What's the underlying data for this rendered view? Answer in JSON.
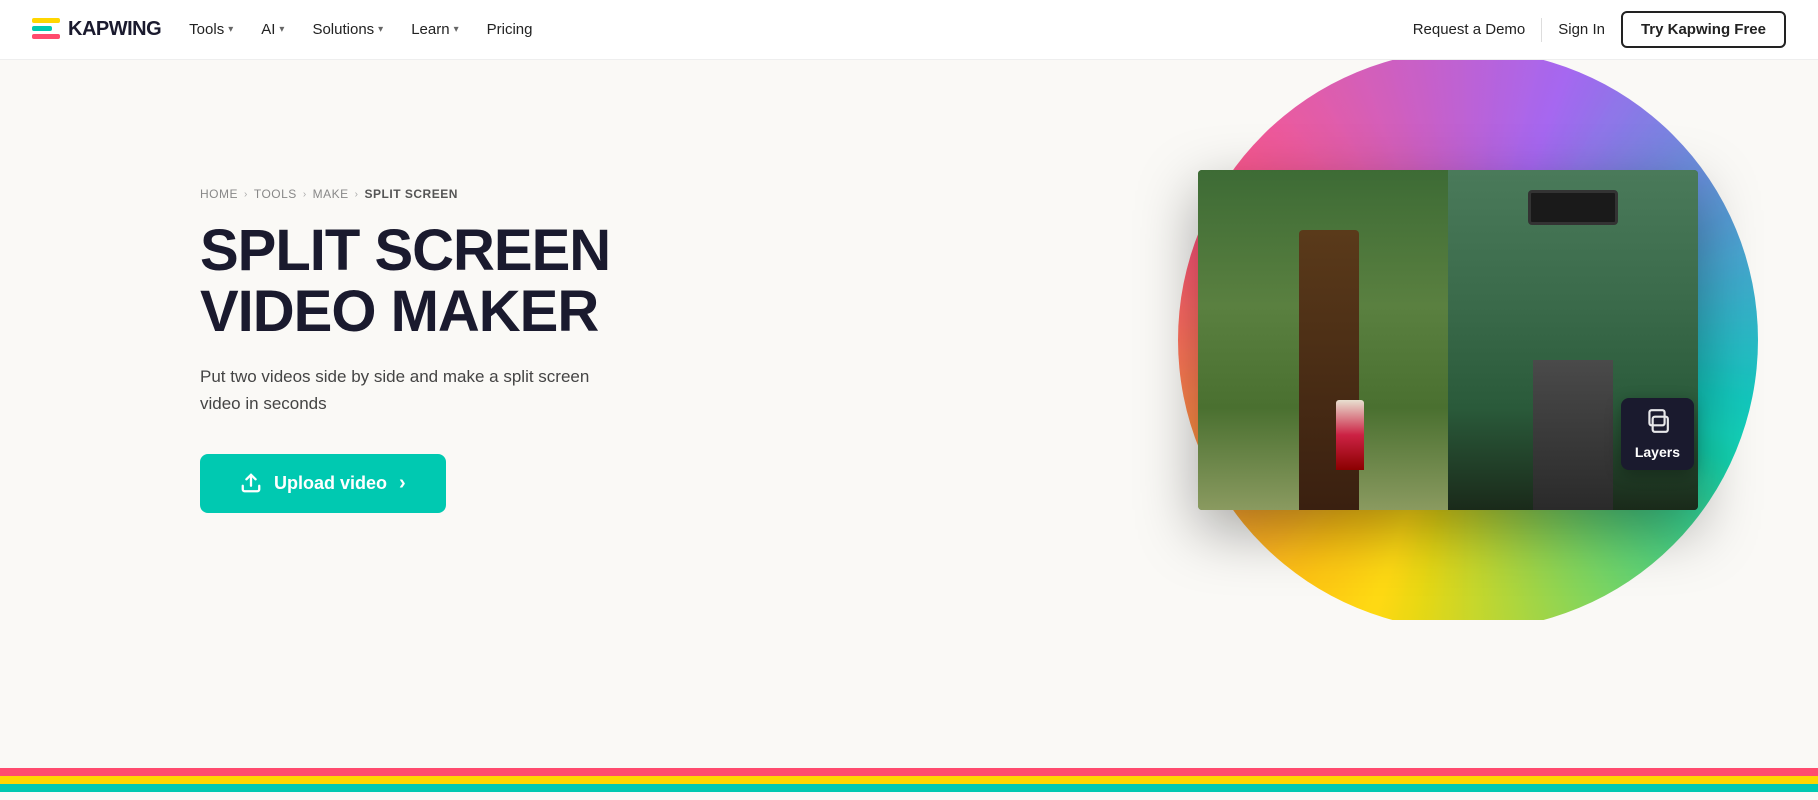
{
  "nav": {
    "logo_text": "KAPWING",
    "links": [
      {
        "label": "Tools",
        "has_dropdown": true
      },
      {
        "label": "AI",
        "has_dropdown": true
      },
      {
        "label": "Solutions",
        "has_dropdown": true
      },
      {
        "label": "Learn",
        "has_dropdown": true
      },
      {
        "label": "Pricing",
        "has_dropdown": false
      }
    ],
    "cta_demo": "Request a Demo",
    "cta_signin": "Sign In",
    "cta_try": "Try Kapwing Free"
  },
  "breadcrumb": {
    "home": "HOME",
    "tools": "TOOLS",
    "make": "MAKE",
    "current": "SPLIT SCREEN"
  },
  "hero": {
    "title_line1": "SPLIT SCREEN",
    "title_line2": "VIDEO MAKER",
    "description": "Put two videos side by side and make a split screen video in seconds",
    "upload_btn": "Upload video",
    "upload_arrow": "›"
  },
  "badge": {
    "label": "Layers"
  },
  "colors": {
    "teal": "#00C9B1",
    "red": "#FF4B6E",
    "yellow": "#FFD600",
    "purple": "#9B5DE5",
    "dark": "#1a1a2e"
  }
}
